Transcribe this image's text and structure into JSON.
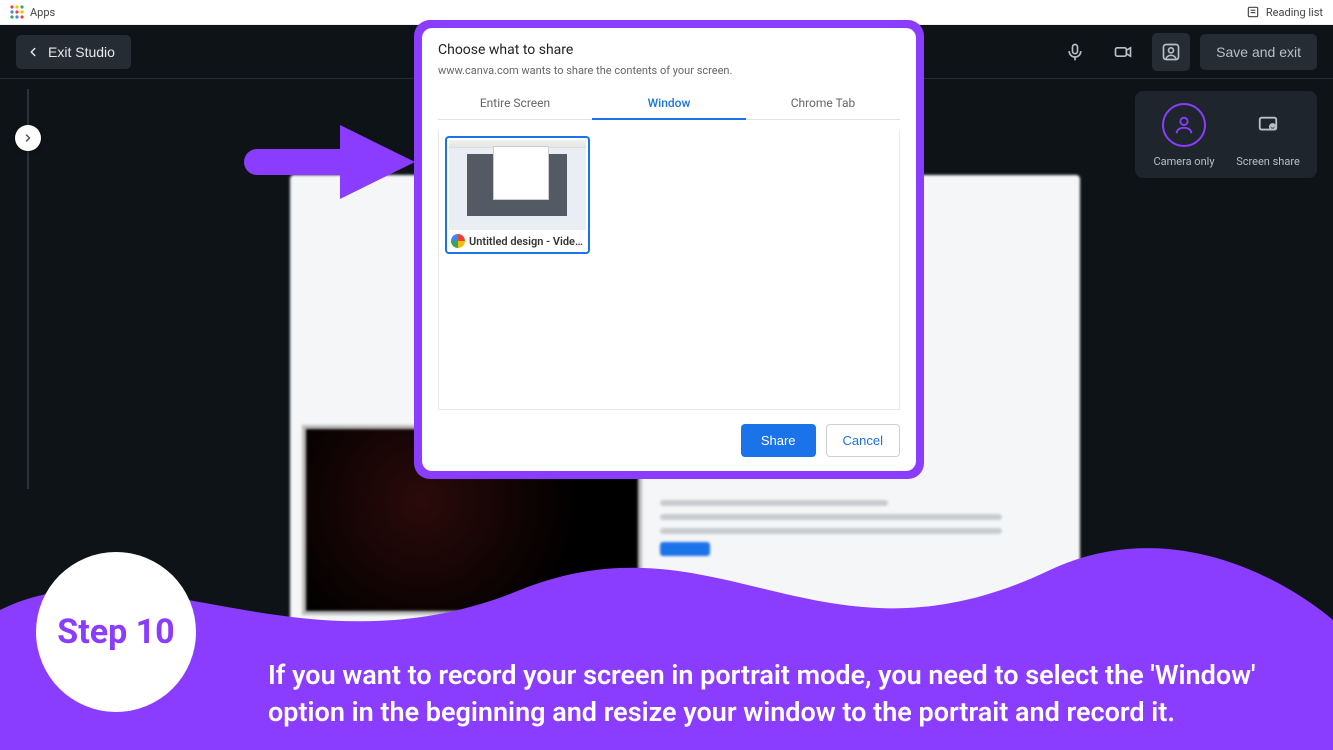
{
  "chrome": {
    "apps_label": "Apps",
    "reading_list": "Reading list"
  },
  "toolbar": {
    "exit_label": "Exit Studio",
    "save_label": "Save and exit"
  },
  "modes": {
    "camera_label": "Camera only",
    "screen_label": "Screen share"
  },
  "dialog": {
    "title": "Choose what to share",
    "subtitle": "www.canva.com wants to share the contents of your screen.",
    "tabs": [
      "Entire Screen",
      "Window",
      "Chrome Tab"
    ],
    "active_tab_index": 1,
    "window_item_label": "Untitled design - Vide…",
    "share_btn": "Share",
    "cancel_btn": "Cancel"
  },
  "step": {
    "badge": "Step 10",
    "text": "If you want to record your screen in portrait mode, you need to select the 'Window' option in the beginning and resize your window to the portrait and record it."
  }
}
